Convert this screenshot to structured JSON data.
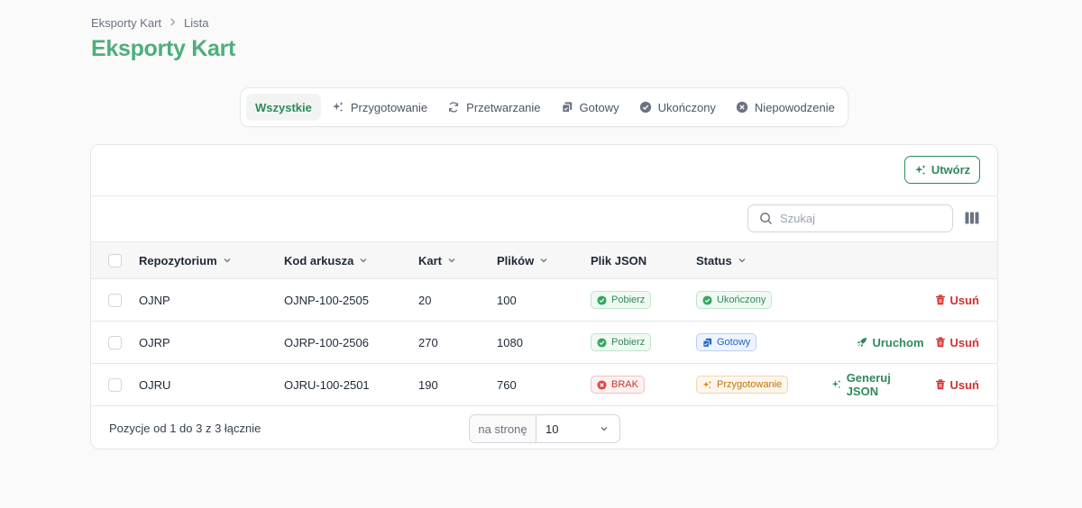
{
  "breadcrumb": {
    "parent": "Eksporty Kart",
    "current": "Lista"
  },
  "page_title": "Eksporty Kart",
  "tabs": [
    {
      "label": "Wszystkie",
      "icon": "none",
      "active": true
    },
    {
      "label": "Przygotowanie",
      "icon": "sparkles-icon"
    },
    {
      "label": "Przetwarzanie",
      "icon": "refresh-icon"
    },
    {
      "label": "Gotowy",
      "icon": "documents-icon"
    },
    {
      "label": "Ukończony",
      "icon": "check-circle-icon"
    },
    {
      "label": "Niepowodzenie",
      "icon": "x-circle-icon"
    }
  ],
  "create_button": {
    "label": "Utwórz",
    "icon": "sparkles-icon"
  },
  "search": {
    "placeholder": "Szukaj",
    "value": ""
  },
  "table": {
    "headers": {
      "repo": "Repozytorium",
      "code": "Kod arkusza",
      "cards": "Kart",
      "files": "Plików",
      "json": "Plik JSON",
      "status": "Status"
    },
    "rows": [
      {
        "repo": "OJNP",
        "code": "OJNP-100-2505",
        "cards": "20",
        "files": "100",
        "json": "Pobierz",
        "status": "Ukończony",
        "action_primary": "",
        "action_delete": "Usuń"
      },
      {
        "repo": "OJRP",
        "code": "OJRP-100-2506",
        "cards": "270",
        "files": "1080",
        "json": "Pobierz",
        "status": "Gotowy",
        "action_primary": "Uruchom",
        "action_delete": "Usuń"
      },
      {
        "repo": "OJRU",
        "code": "OJRU-100-2501",
        "cards": "190",
        "files": "760",
        "json": "BRAK",
        "status": "Przygotowanie",
        "action_primary": "Generuj JSON",
        "action_delete": "Usuń"
      }
    ]
  },
  "footer": {
    "summary": "Pozycje od 1 do 3 z 3 łącznie",
    "per_page_label": "na stronę",
    "per_page_value": "10"
  },
  "colors": {
    "accent": "#2f8a5a",
    "title": "#4caf7a",
    "danger": "#d32f2f",
    "info": "#2563c9",
    "warning": "#c2720c"
  }
}
